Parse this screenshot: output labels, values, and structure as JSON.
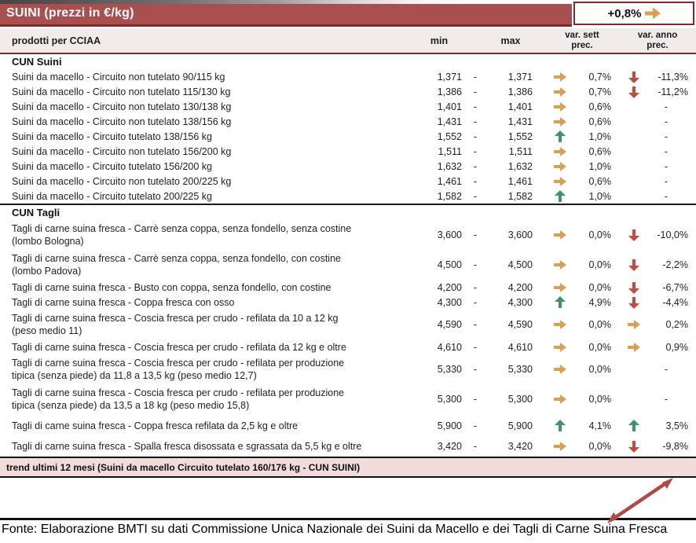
{
  "title_bar": {
    "title": "SUINI (prezzi in €/kg)"
  },
  "badge": {
    "value": "+0,8%",
    "icon": "right-arrow"
  },
  "columns": {
    "product": "prodotti per CCIAA",
    "min": "min",
    "max": "max",
    "sett_line1": "var. sett",
    "sett_line2": "prec.",
    "anno_line1": "var. anno",
    "anno_line2": "prec."
  },
  "table": {
    "sections": [
      {
        "label": "CUN Suini",
        "rows": [
          {
            "name": "Suini da macello - Circuito non tutelato 90/115 kg",
            "min": "1,371",
            "sep": "-",
            "max": "1,371",
            "sett_dir": "right",
            "sett_pct": "0,7%",
            "anno_dir": "down",
            "anno_pct": "-11,3%"
          },
          {
            "name": "Suini da macello - Circuito non tutelato 115/130 kg",
            "min": "1,386",
            "sep": "-",
            "max": "1,386",
            "sett_dir": "right",
            "sett_pct": "0,7%",
            "anno_dir": "down",
            "anno_pct": "-11,2%"
          },
          {
            "name": "Suini da macello - Circuito non tutelato 130/138 kg",
            "min": "1,401",
            "sep": "-",
            "max": "1,401",
            "sett_dir": "right",
            "sett_pct": "0,6%",
            "anno_dir": "",
            "anno_pct": "-"
          },
          {
            "name": "Suini da macello - Circuito non tutelato 138/156 kg",
            "min": "1,431",
            "sep": "-",
            "max": "1,431",
            "sett_dir": "right",
            "sett_pct": "0,6%",
            "anno_dir": "",
            "anno_pct": "-"
          },
          {
            "name": "Suini da macello - Circuito tutelato 138/156 kg",
            "min": "1,552",
            "sep": "-",
            "max": "1,552",
            "sett_dir": "up",
            "sett_pct": "1,0%",
            "anno_dir": "",
            "anno_pct": "-"
          },
          {
            "name": "Suini da macello - Circuito non tutelato 156/200 kg",
            "min": "1,511",
            "sep": "-",
            "max": "1,511",
            "sett_dir": "right",
            "sett_pct": "0,6%",
            "anno_dir": "",
            "anno_pct": "-"
          },
          {
            "name": "Suini da macello - Circuito tutelato 156/200 kg",
            "min": "1,632",
            "sep": "-",
            "max": "1,632",
            "sett_dir": "right",
            "sett_pct": "1,0%",
            "anno_dir": "",
            "anno_pct": "-"
          },
          {
            "name": "Suini da macello - Circuito non tutelato 200/225 kg",
            "min": "1,461",
            "sep": "-",
            "max": "1,461",
            "sett_dir": "right",
            "sett_pct": "0,6%",
            "anno_dir": "",
            "anno_pct": "-"
          },
          {
            "name": "Suini da macello - Circuito tutelato 200/225 kg",
            "min": "1,582",
            "sep": "-",
            "max": "1,582",
            "sett_dir": "up",
            "sett_pct": "1,0%",
            "anno_dir": "",
            "anno_pct": "-"
          }
        ]
      },
      {
        "label": "CUN Tagli",
        "rows": [
          {
            "name": "Tagli di carne suina fresca - Carrè senza coppa, senza fondello, senza costine\n(lombo Bologna)",
            "min": "3,600",
            "sep": "-",
            "max": "3,600",
            "sett_dir": "right",
            "sett_pct": "0,0%",
            "anno_dir": "down",
            "anno_pct": "-10,0%"
          },
          {
            "name": "Tagli di carne suina fresca - Carrè senza coppa, senza fondello, con costine\n(lombo Padova)",
            "min": "4,500",
            "sep": "-",
            "max": "4,500",
            "sett_dir": "right",
            "sett_pct": "0,0%",
            "anno_dir": "down",
            "anno_pct": "-2,2%"
          },
          {
            "name": "Tagli di carne suina fresca - Busto con coppa, senza fondello, con costine",
            "min": "4,200",
            "sep": "-",
            "max": "4,200",
            "sett_dir": "right",
            "sett_pct": "0,0%",
            "anno_dir": "down",
            "anno_pct": "-6,7%"
          },
          {
            "name": "Tagli di carne suina fresca - Coppa fresca con osso",
            "min": "4,300",
            "sep": "-",
            "max": "4,300",
            "sett_dir": "up",
            "sett_pct": "4,9%",
            "anno_dir": "down",
            "anno_pct": "-4,4%"
          },
          {
            "name": "Tagli di carne suina fresca - Coscia fresca per crudo - refilata da 10 a 12 kg\n(peso medio 11)",
            "min": "4,590",
            "sep": "-",
            "max": "4,590",
            "sett_dir": "right",
            "sett_pct": "0,0%",
            "anno_dir": "right",
            "anno_pct": "0,2%"
          },
          {
            "name": "Tagli di carne suina fresca - Coscia fresca per crudo - refilata da 12 kg e oltre",
            "min": "4,610",
            "sep": "-",
            "max": "4,610",
            "sett_dir": "right",
            "sett_pct": "0,0%",
            "anno_dir": "right",
            "anno_pct": "0,9%"
          },
          {
            "name": "Tagli di carne suina fresca - Coscia fresca per crudo - refilata per produzione\ntipica (senza piede) da 11,8 a 13,5 kg (peso medio 12,7)",
            "min": "5,330",
            "sep": "-",
            "max": "5,330",
            "sett_dir": "right",
            "sett_pct": "0,0%",
            "anno_dir": "",
            "anno_pct": "-"
          },
          {
            "name": "Tagli di carne suina fresca - Coscia fresca per crudo - refilata per produzione\ntipica (senza piede) da 13,5 a 18 kg (peso medio 15,8)",
            "min": "5,300",
            "sep": "-",
            "max": "5,300",
            "sett_dir": "right",
            "sett_pct": "0,0%",
            "anno_dir": "",
            "anno_pct": "-"
          },
          {
            "name": "Tagli di carne suina fresca - Coppa fresca refilata da 2,5 kg e oltre",
            "min": "5,900",
            "sep": "-",
            "max": "5,900",
            "sett_dir": "up",
            "sett_pct": "4,1%",
            "anno_dir": "up",
            "anno_pct": "3,5%"
          },
          {
            "name": "Tagli di carne suina fresca - Spalla fresca disossata e sgrassata da 5,5 kg e oltre",
            "min": "3,420",
            "sep": "-",
            "max": "3,420",
            "sett_dir": "right",
            "sett_pct": "0,0%",
            "anno_dir": "down",
            "anno_pct": "-9,8%"
          }
        ]
      }
    ]
  },
  "trend": {
    "label": "trend ultimi 12 mesi (Suini da macello Circuito tutelato 160/176 kg - CUN SUINI)"
  },
  "footer": {
    "source": "Fonte: Elaborazione BMTI su dati Commissione Unica Nazionale dei Suini da Macello e dei Tagli di Carne Suina Fresca"
  },
  "colors": {
    "header_red": "#A94F4F",
    "border_dark_red": "#7E2B2B",
    "pink_bar": "#F2DCDB",
    "arrow_up": "#3E9467",
    "arrow_down": "#C14B41",
    "arrow_right": "#D9A052",
    "trend_line": "#AE4A44"
  },
  "chart_data": {
    "type": "line",
    "title": "trend ultimi 12 mesi (Suini da macello Circuito tutelato 160/176 kg - CUN SUINI)",
    "note": "only a rising red trend-line segment with arrowheads is visible in the cropped chart area",
    "visible_segment": {
      "direction": "up",
      "color": "#AE4A44"
    }
  }
}
